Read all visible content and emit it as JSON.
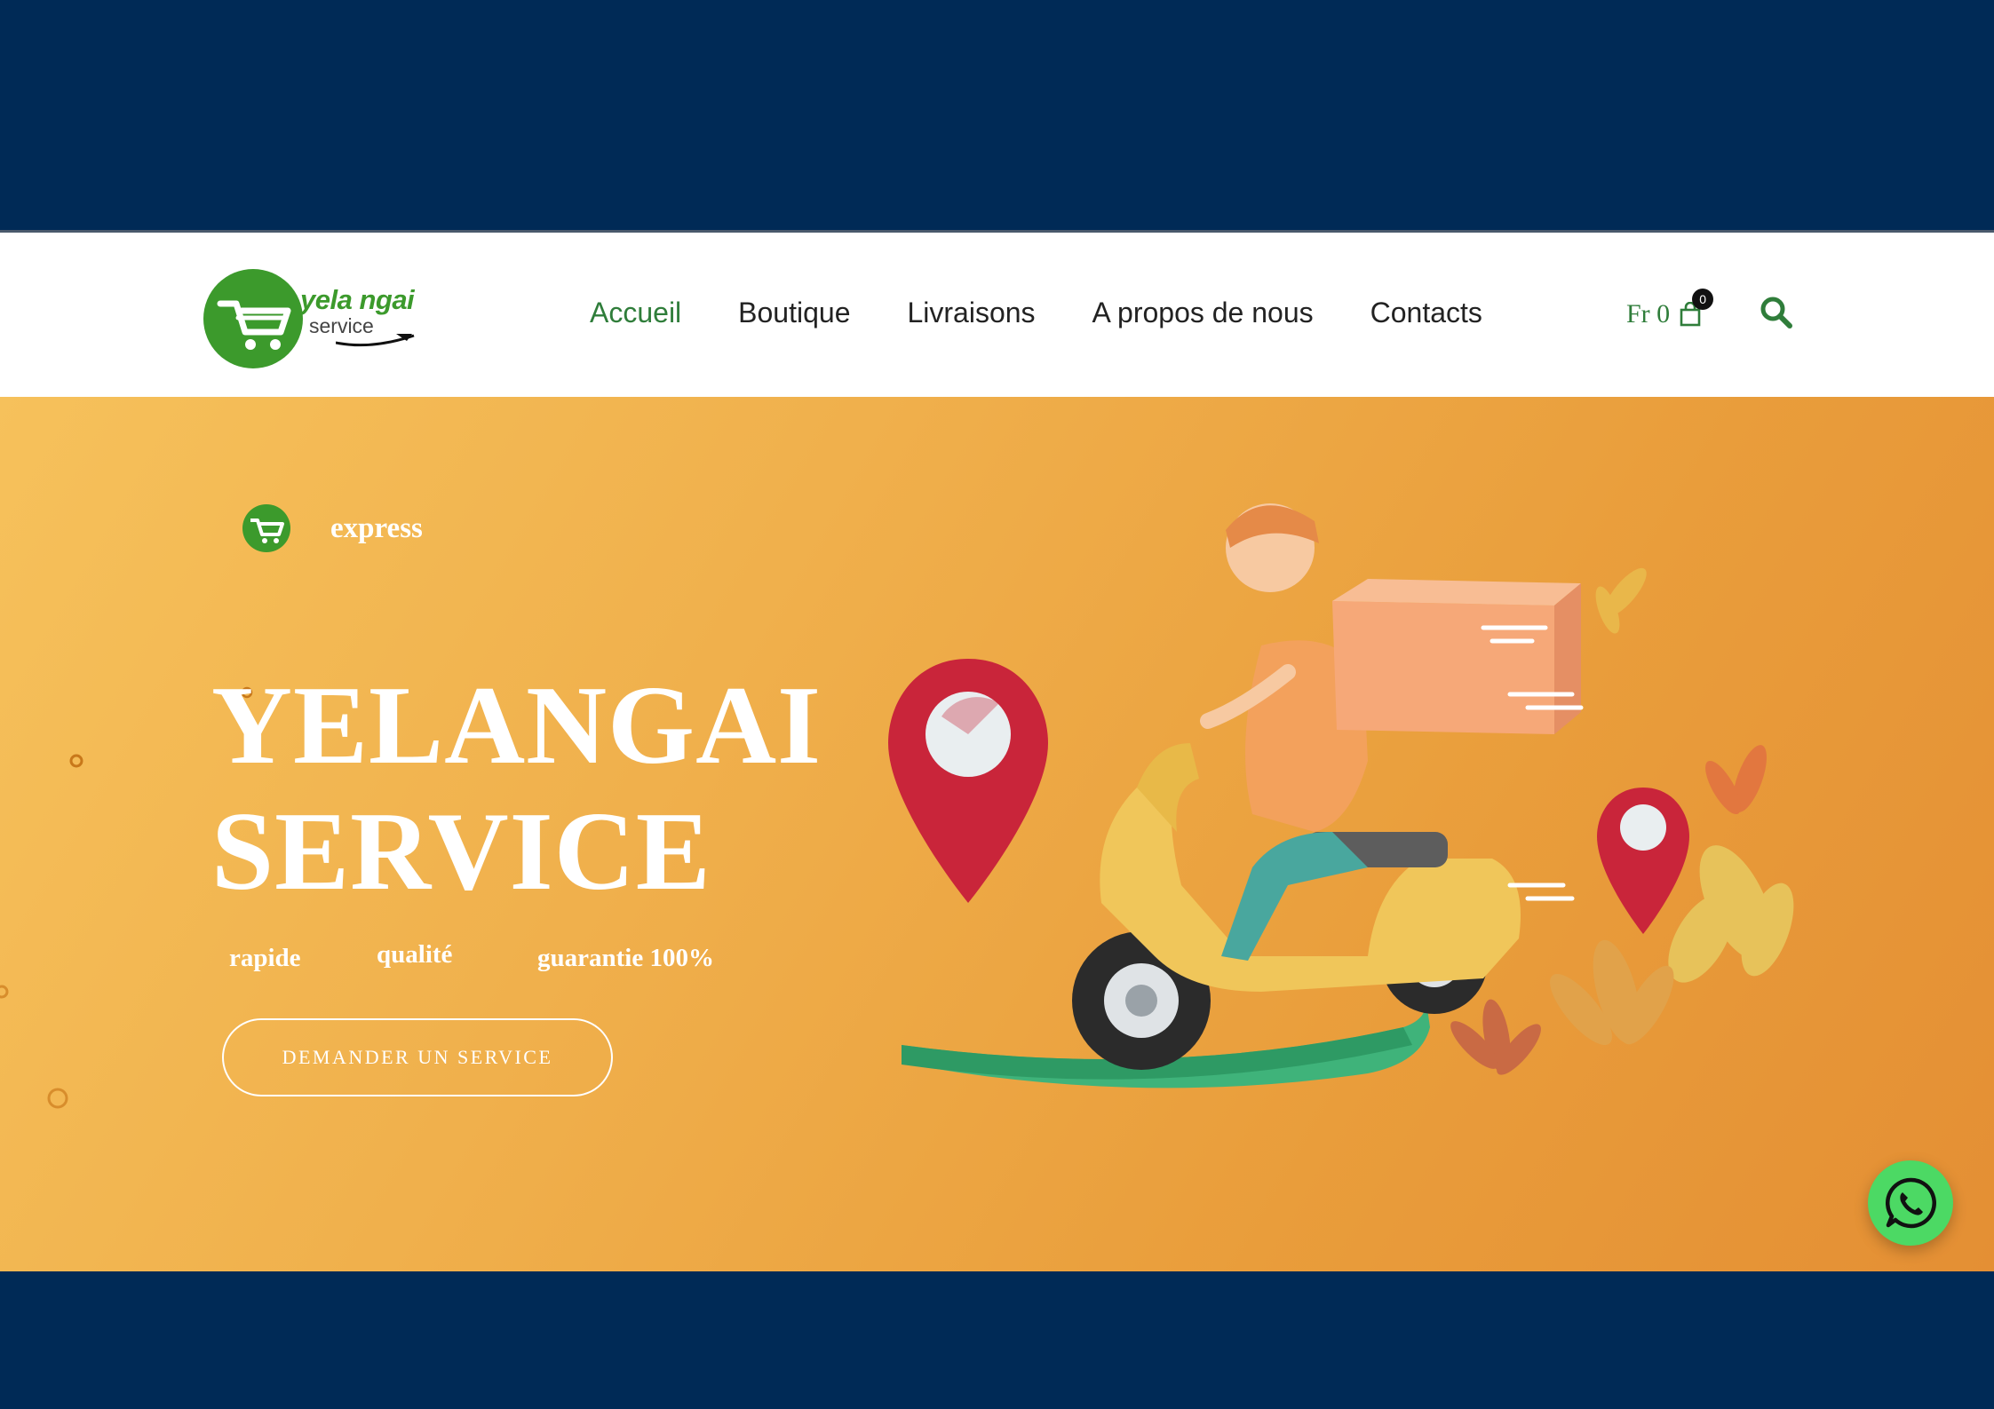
{
  "header": {
    "logo": {
      "name": "yela ngai",
      "sub": "service"
    },
    "nav": [
      {
        "label": "Accueil",
        "active": true
      },
      {
        "label": "Boutique",
        "active": false
      },
      {
        "label": "Livraisons",
        "active": false
      },
      {
        "label": "A propos de nous",
        "active": false
      },
      {
        "label": "Contacts",
        "active": false
      }
    ],
    "cart": {
      "text": "Fr 0",
      "count": "0"
    },
    "search_icon": "search-icon"
  },
  "hero": {
    "badge_text": "express",
    "title_line1": "YELANGAI",
    "title_line2": "SERVICE",
    "features": [
      "rapide",
      "qualité",
      "guarantie 100%"
    ],
    "cta_label": "DEMANDER UN SERVICE"
  },
  "colors": {
    "frame": "#002a56",
    "brand_green": "#2f7d3a",
    "logo_green": "#3c9a2c",
    "hero_orange": "#eaa140",
    "whatsapp": "#4cd964"
  },
  "whatsapp_icon": "whatsapp-icon"
}
